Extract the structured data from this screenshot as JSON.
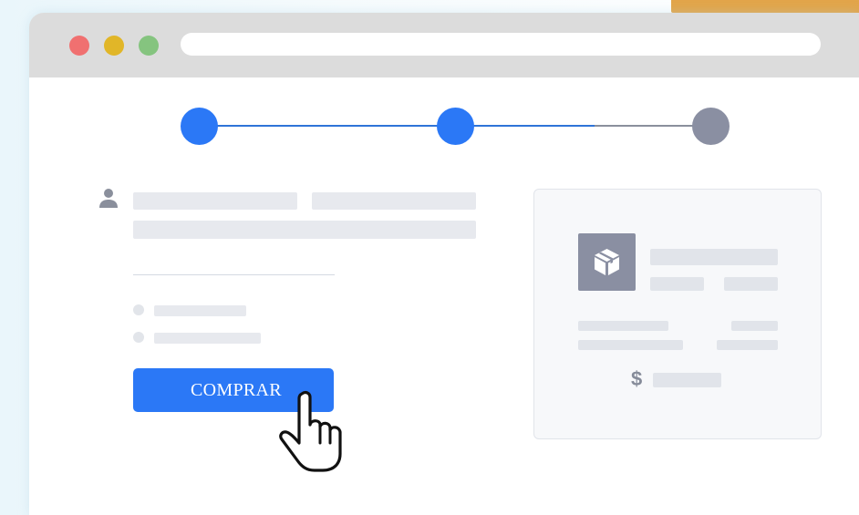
{
  "checkout": {
    "buy_button_label": "COMPRAR"
  },
  "stepper": {
    "total_steps": 3,
    "completed_steps": 2
  },
  "summary": {
    "currency_symbol": "$"
  },
  "icons": {
    "user": "user-icon",
    "product": "package-box-icon",
    "cursor": "hand-pointer-icon"
  },
  "colors": {
    "accent": "#2b78f6",
    "inactive_step": "#8a8fa2",
    "placeholder": "#e7e9ee",
    "corner_accent": "#e2a54a"
  }
}
